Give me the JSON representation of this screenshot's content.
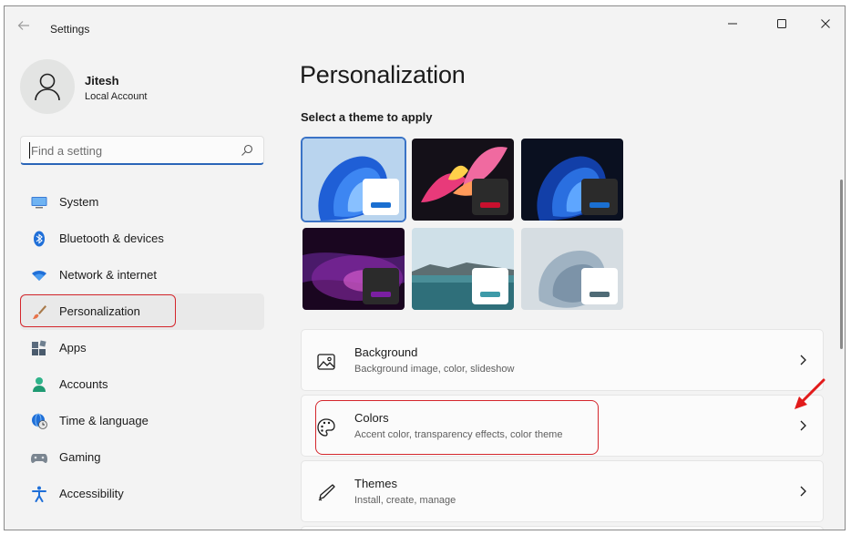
{
  "window": {
    "title": "Settings",
    "controls": {
      "minimize": "minimize-icon",
      "maximize": "maximize-icon",
      "close": "close-icon"
    }
  },
  "profile": {
    "name": "Jitesh",
    "account_type": "Local Account"
  },
  "search": {
    "placeholder": "Find a setting",
    "value": ""
  },
  "sidebar": {
    "items": [
      {
        "label": "System",
        "icon": "monitor-icon"
      },
      {
        "label": "Bluetooth & devices",
        "icon": "bluetooth-icon"
      },
      {
        "label": "Network & internet",
        "icon": "wifi-icon"
      },
      {
        "label": "Personalization",
        "icon": "paintbrush-icon",
        "selected": true
      },
      {
        "label": "Apps",
        "icon": "apps-icon"
      },
      {
        "label": "Accounts",
        "icon": "person-icon"
      },
      {
        "label": "Time & language",
        "icon": "globe-clock-icon"
      },
      {
        "label": "Gaming",
        "icon": "gamepad-icon"
      },
      {
        "label": "Accessibility",
        "icon": "accessibility-icon"
      }
    ]
  },
  "main": {
    "title": "Personalization",
    "themes_label": "Select a theme to apply",
    "themes": [
      {
        "name": "windows-light",
        "accent": "#1a6fd1",
        "chip": "#ffffff",
        "selected": true
      },
      {
        "name": "glow",
        "accent": "#c8102e",
        "chip": "#2b2b2b"
      },
      {
        "name": "windows-dark",
        "accent": "#1a6fd1",
        "chip": "#2b2b2b"
      },
      {
        "name": "captured-motion",
        "accent": "#7b1fa2",
        "chip": "#2b2b2b"
      },
      {
        "name": "sunrise",
        "accent": "#3d9aa8",
        "chip": "#ffffff"
      },
      {
        "name": "flow",
        "accent": "#4f6b76",
        "chip": "#ffffff"
      }
    ],
    "cards": [
      {
        "title": "Background",
        "subtitle": "Background image, color, slideshow",
        "icon": "image-icon"
      },
      {
        "title": "Colors",
        "subtitle": "Accent color, transparency effects, color theme",
        "icon": "palette-icon"
      },
      {
        "title": "Themes",
        "subtitle": "Install, create, manage",
        "icon": "pen-icon"
      }
    ]
  },
  "colors": {
    "accent": "#2a65b8",
    "highlight": "#d4262c",
    "background": "#f3f3f3",
    "card": "#fbfbfb"
  }
}
